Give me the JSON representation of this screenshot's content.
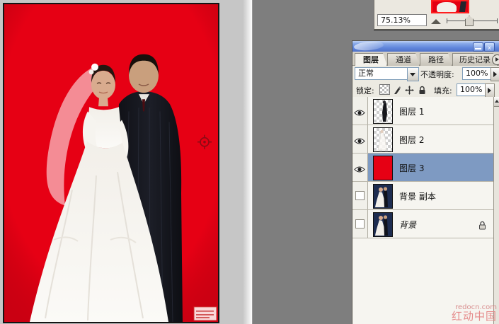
{
  "navigator": {
    "zoom_value": "75.13%"
  },
  "layers_panel": {
    "tabs": [
      {
        "label": "图层",
        "active": true
      },
      {
        "label": "通道",
        "active": false
      },
      {
        "label": "路径",
        "active": false
      },
      {
        "label": "历史记录",
        "active": false
      }
    ],
    "blend_mode_value": "正常",
    "opacity_label": "不透明度:",
    "opacity_value": "100%",
    "lock_label": "锁定:",
    "fill_label": "填充:",
    "fill_value": "100%",
    "layers": [
      {
        "name": "图层 1",
        "visible": true,
        "selected": false,
        "thumb": "groom-cutout-on-transparency"
      },
      {
        "name": "图层 2",
        "visible": true,
        "selected": false,
        "thumb": "bride-cutout-on-transparency"
      },
      {
        "name": "图层 3",
        "visible": true,
        "selected": true,
        "thumb": "solid-red-fill"
      },
      {
        "name": "背景 副本",
        "visible": false,
        "selected": false,
        "thumb": "wedding-photo"
      },
      {
        "name": "背景",
        "visible": false,
        "selected": false,
        "thumb": "wedding-photo",
        "locked": true
      }
    ]
  },
  "controls": {
    "minimize_glyph": "",
    "close_glyph": "x"
  },
  "watermark": {
    "line1": "redocn.com",
    "line2": "红动中国"
  },
  "colors": {
    "canvas_red": "#e60014",
    "workspace_gray": "#7e7e7e",
    "selected_layer_blue": "#7e9ac2",
    "titlebar_blue": "#6f93e0"
  }
}
